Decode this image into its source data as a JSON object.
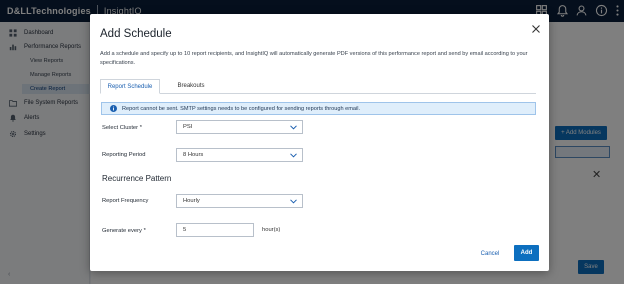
{
  "app": {
    "brand_company": "D&LLTechnologies",
    "brand_product": "InsightIQ"
  },
  "topbar": {
    "icons": [
      "dashboard-icon",
      "bell-icon",
      "user-icon",
      "help-icon",
      "kebab-menu-icon"
    ]
  },
  "sidebar": {
    "items": [
      {
        "label": "Dashboard",
        "icon": "grid-icon"
      },
      {
        "label": "Performance Reports",
        "icon": "chart-icon"
      },
      {
        "label": "File System Reports",
        "icon": "folder-icon"
      },
      {
        "label": "Alerts",
        "icon": "bell-icon"
      },
      {
        "label": "Settings",
        "icon": "gear-icon"
      }
    ],
    "sub_items": [
      "View Reports",
      "Manage Reports",
      "Create Report"
    ],
    "active_sub": "Create Report",
    "collapse": "‹"
  },
  "background": {
    "add_modules": "+ Add Modules",
    "save": "Save"
  },
  "modal": {
    "title": "Add Schedule",
    "description": "Add a schedule and specify up to 10 report recipients, and InsightIQ will automatically generate PDF versions of this performance report and send by email according to your specifications.",
    "tabs": [
      "Report Schedule",
      "Breakouts"
    ],
    "active_tab": "Report Schedule",
    "alert": "Report cannot be sent. SMTP settings needs to be configured for sending reports through email.",
    "fields": {
      "cluster": {
        "label": "Select Cluster *",
        "value": "PSI"
      },
      "period": {
        "label": "Reporting Period",
        "value": "8 Hours"
      },
      "recurrence_heading": "Recurrence Pattern",
      "frequency": {
        "label": "Report Frequency",
        "value": "Hourly"
      },
      "generate": {
        "label": "Generate every *",
        "value": "5",
        "unit": "hour(s)"
      }
    },
    "buttons": {
      "cancel": "Cancel",
      "add": "Add"
    }
  },
  "colors": {
    "topbar": "#0b1f3a",
    "primary": "#0d6fbf",
    "alert_bg": "#dfeefb",
    "overlay": "rgba(0,0,0,0.5)"
  }
}
